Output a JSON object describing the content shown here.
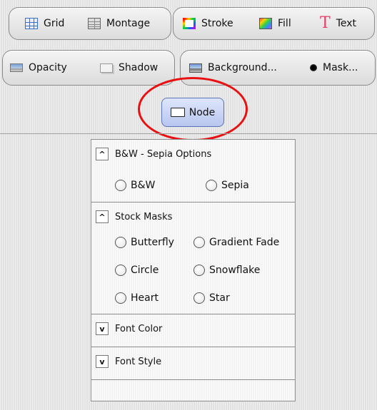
{
  "toolbar": {
    "row1": {
      "grid": {
        "label": "Grid",
        "icon": "grid-icon"
      },
      "montage": {
        "label": "Montage",
        "icon": "montage-icon"
      },
      "stroke": {
        "label": "Stroke",
        "icon": "stroke-icon"
      },
      "fill": {
        "label": "Fill",
        "icon": "fill-icon"
      },
      "text": {
        "label": "Text",
        "icon": "text-icon",
        "glyph": "T"
      }
    },
    "row2": {
      "opacity": {
        "label": "Opacity",
        "icon": "opacity-icon"
      },
      "shadow": {
        "label": "Shadow",
        "icon": "shadow-icon"
      },
      "background": {
        "label": "Background...",
        "icon": "background-icon"
      },
      "mask": {
        "label": "Mask...",
        "icon": "mask-icon"
      }
    },
    "node": {
      "label": "Node",
      "icon": "node-icon",
      "active": true
    }
  },
  "panel": {
    "bw_sepia": {
      "title": "B&W - Sepia Options",
      "expanded": true,
      "toggle_glyph": "^",
      "options": [
        "B&W",
        "Sepia"
      ]
    },
    "stock_masks": {
      "title": "Stock Masks",
      "expanded": true,
      "toggle_glyph": "^",
      "options": [
        "Butterfly",
        "Gradient Fade",
        "Circle",
        "Snowflake",
        "Heart",
        "Star"
      ]
    },
    "font_color": {
      "title": "Font Color",
      "expanded": false,
      "toggle_glyph": "v"
    },
    "font_style": {
      "title": "Font Style",
      "expanded": false,
      "toggle_glyph": "v"
    }
  },
  "colors": {
    "highlight_ring": "#e81010",
    "node_active_bg": "#c9d4f5"
  }
}
